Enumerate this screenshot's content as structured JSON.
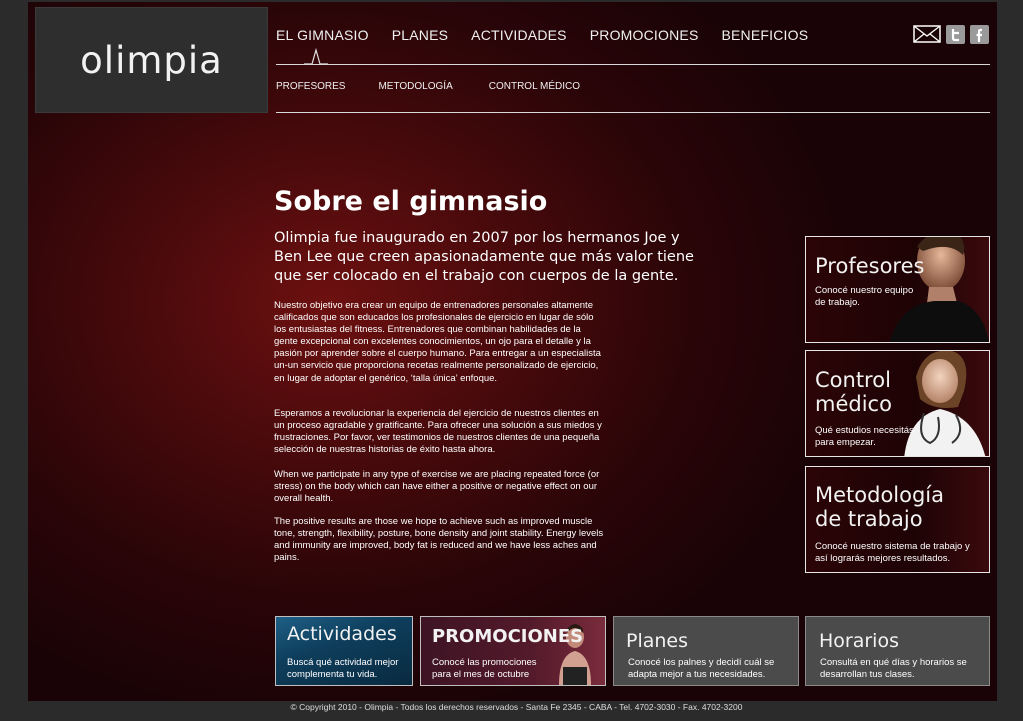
{
  "logo": {
    "text": "olimpia"
  },
  "nav": {
    "main": [
      "EL GIMNASIO",
      "PLANES",
      "ACTIVIDADES",
      "PROMOCIONES",
      "BENEFICIOS"
    ],
    "sub": [
      "PROFESORES",
      "METODOLOGÍA",
      "CONTROL MÉDICO"
    ]
  },
  "social": [
    "mail-icon",
    "twitter-icon",
    "facebook-icon"
  ],
  "content": {
    "title": "Sobre el gimnasio",
    "lead": "Olimpia fue inaugurado en 2007 por los hermanos Joe y Ben Lee que creen apasionadamente que más valor tiene que ser colocado en el trabajo con cuerpos de la gente.",
    "p1": "Nuestro objetivo era crear un equipo de entrenadores personales altamente calificados que son educados los profesionales de ejercicio en lugar de sólo los entusiastas del fitness. Entrenadores que combinan habilidades de la gente excepcional con excelentes conocimientos, un ojo para el detalle y la pasión por aprender sobre el cuerpo humano. Para entregar a un especialista un-un servicio que proporciona recetas realmente personalizado de ejercicio, en lugar de adoptar el genérico, ‘talla única’ enfoque.",
    "p2": "Esperamos a revolucionar la experiencia del ejercicio de nuestros clientes en un proceso agradable y gratificante. Para ofrecer una solución a sus miedos y frustraciones. Por favor, ver testimonios de nuestros clientes de una pequeña selección de nuestras historias de éxito hasta ahora.",
    "p3": "When we participate in any type of exercise we are placing repeated force (or stress) on the body which can have either a positive or negative effect on our overall health.",
    "p4": "The positive results are those we hope to achieve such as improved muscle tone, strength, flexibility, posture, bone density and joint stability. Energy levels and immunity are improved, body fat is reduced and we have less aches and pains."
  },
  "side_cards": [
    {
      "title": "Profesores",
      "desc": "Conocé nuestro equipo de trabajo."
    },
    {
      "title": "Control médico",
      "desc": "Qué estudios necesitás para empezar."
    },
    {
      "title": "Metodología de trabajo",
      "desc": "Conocé nuestro sistema de trabajo y así lograrás mejores resultados."
    }
  ],
  "bottom_cards": [
    {
      "title": "Actividades",
      "desc": "Buscá qué actividad mejor complementa tu vida."
    },
    {
      "title": "PROMOCIONES",
      "desc": "Conocé las promociones para el mes de octubre"
    },
    {
      "title": "Planes",
      "desc": "Conocé los palnes y decidí cuál se adapta mejor a tus necesidades."
    },
    {
      "title": "Horarios",
      "desc": "Consultá en qué días y horarios se desarrollan tus clases."
    }
  ],
  "footer": "© Copyright 2010 - Olimpia - Todos los derechos reservados - Santa Fe 2345 - CABA - Tel. 4702-3030 - Fax. 4702-3200"
}
